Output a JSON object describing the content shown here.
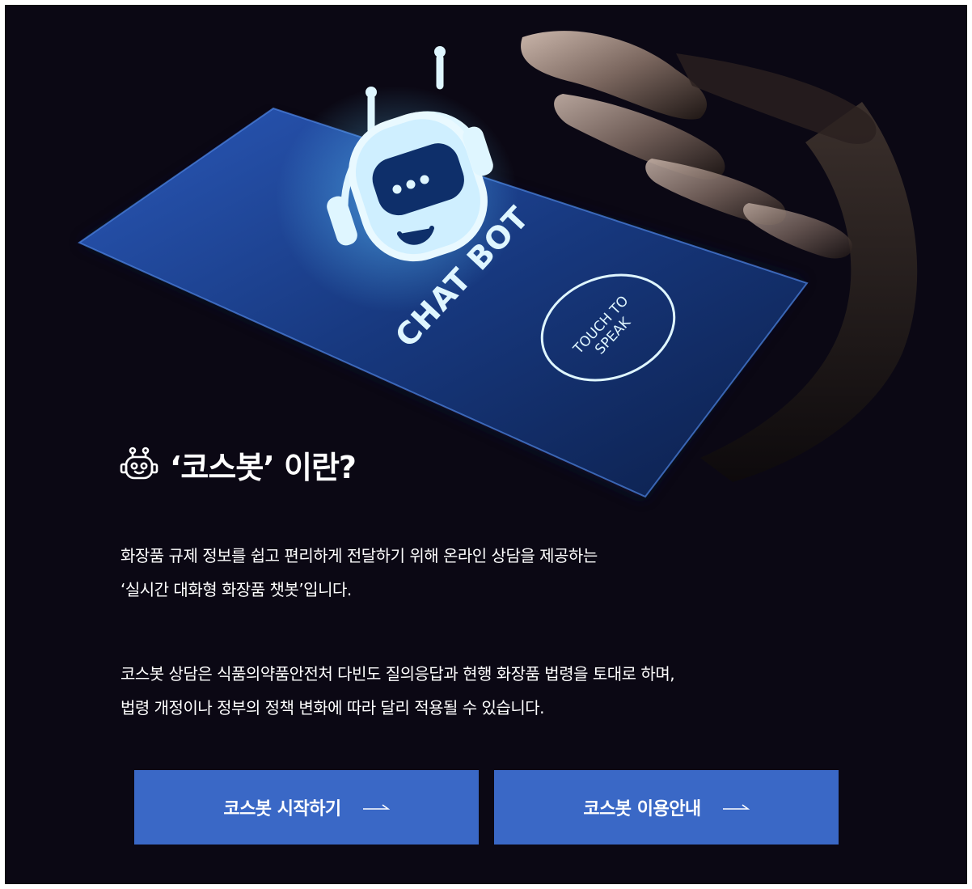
{
  "hero": {
    "card_title": "CHAT BOT",
    "card_button": "TOUCH TO SPEAK",
    "card_button_line1": "TOUCH TO",
    "card_button_line2": "SPEAK"
  },
  "intro": {
    "icon": "robot-icon",
    "title": "‘코스봇’ 이란?",
    "paragraph1": [
      "화장품 규제 정보를 쉽고 편리하게 전달하기 위해 온라인 상담을 제공하는",
      "‘실시간 대화형 화장품 챗봇’입니다."
    ],
    "paragraph2": [
      "코스봇 상담은 식품의약품안전처 다빈도 질의응답과 현행 화장품 법령을 토대로 하며,",
      "법령 개정이나 정부의 정책 변화에 따라 달리 적용될 수 있습니다."
    ]
  },
  "buttons": {
    "start_label": "코스봇 시작하기",
    "guide_label": "코스봇 이용안내",
    "arrow_icon": "long-arrow-right-icon"
  },
  "colors": {
    "background": "#0b0814",
    "button": "#3a68c6",
    "glow": "#6fd3ff",
    "card": "#1a3c8a"
  }
}
